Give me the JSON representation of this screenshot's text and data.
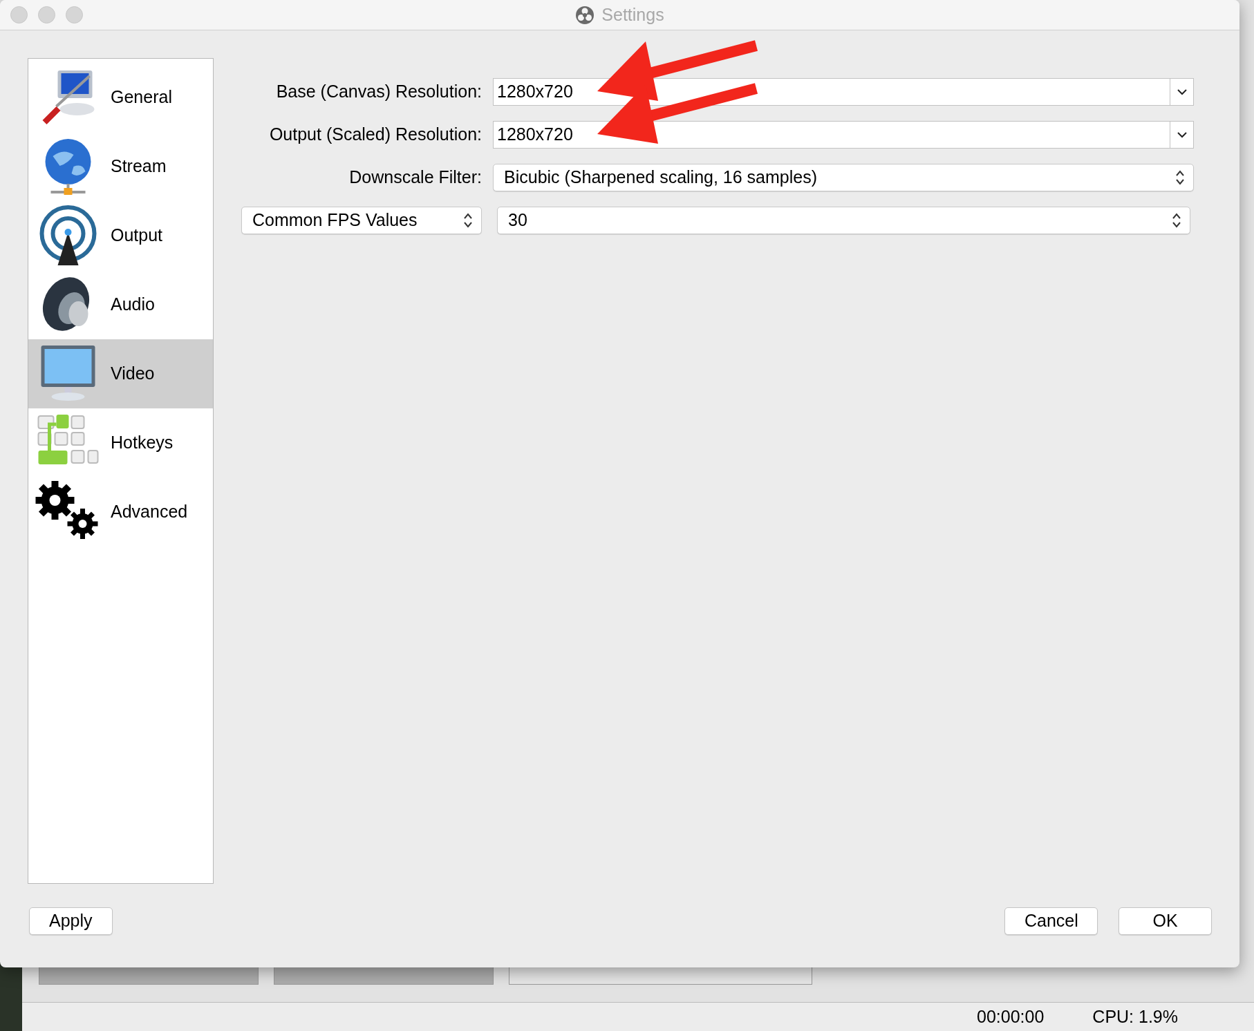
{
  "window": {
    "title": "Settings"
  },
  "sidebar": {
    "items": [
      {
        "label": "General",
        "kind": "general",
        "selected": false
      },
      {
        "label": "Stream",
        "kind": "stream",
        "selected": false
      },
      {
        "label": "Output",
        "kind": "output",
        "selected": false
      },
      {
        "label": "Audio",
        "kind": "audio",
        "selected": false
      },
      {
        "label": "Video",
        "kind": "video",
        "selected": true
      },
      {
        "label": "Hotkeys",
        "kind": "hotkeys",
        "selected": false
      },
      {
        "label": "Advanced",
        "kind": "advanced",
        "selected": false
      }
    ]
  },
  "form": {
    "rows": [
      {
        "kind": "combo",
        "label": "Base (Canvas) Resolution:",
        "value": "1280x720",
        "annotated": true
      },
      {
        "kind": "combo",
        "label": "Output (Scaled) Resolution:",
        "value": "1280x720",
        "annotated": true
      },
      {
        "kind": "select",
        "label": "Downscale Filter:",
        "value": "Bicubic (Sharpened scaling, 16 samples)",
        "annotated": false
      },
      {
        "kind": "select-pair",
        "selector": "Common FPS Values",
        "value": "30",
        "annotated": false
      }
    ]
  },
  "buttons": {
    "left": [
      "Apply"
    ],
    "right": [
      "Cancel",
      "OK"
    ]
  },
  "background_app": {
    "status_bar": {
      "time": "00:00:00",
      "cpu": "CPU: 1.9%"
    }
  }
}
